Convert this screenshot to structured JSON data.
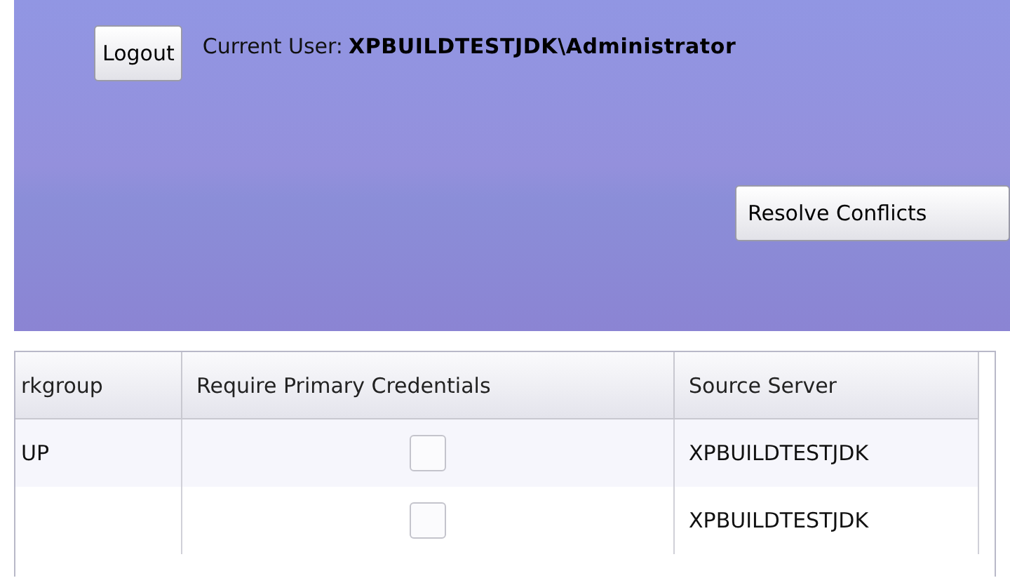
{
  "header": {
    "logout_button": "Logout",
    "current_user_label": "Current User:",
    "current_user": "XPBUILDTESTJDK\\Administrator",
    "resolve_button": "Resolve Conflicts"
  },
  "table": {
    "columns": [
      "rkgroup",
      "Require Primary Credentials",
      "Source Server"
    ],
    "rows": [
      {
        "workgroup": "UP",
        "require_primary_credentials": false,
        "source_server": "XPBUILDTESTJDK"
      },
      {
        "require_primary_credentials": false,
        "source_server": "XPBUILDTESTJDK"
      }
    ]
  }
}
